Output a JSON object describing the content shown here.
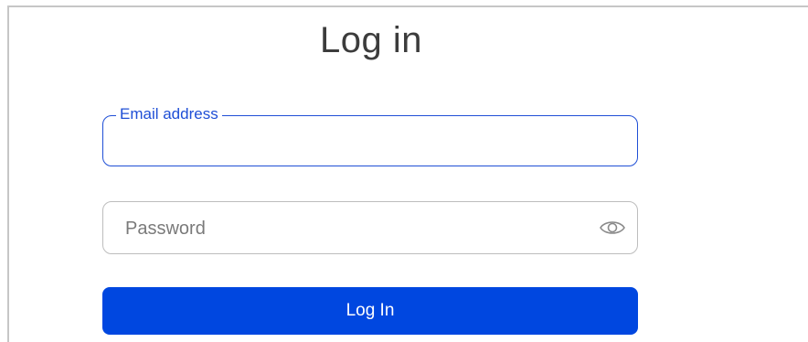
{
  "page": {
    "title": "Log in"
  },
  "form": {
    "email": {
      "label": "Email address",
      "value": ""
    },
    "password": {
      "placeholder": "Password",
      "value": "",
      "toggle_icon": "eye-icon"
    },
    "submit_label": "Log In"
  },
  "colors": {
    "accent": "#1f4fd6",
    "button_bg": "#0047e0",
    "button_text": "#ffffff",
    "border": "#bdbdbd"
  }
}
